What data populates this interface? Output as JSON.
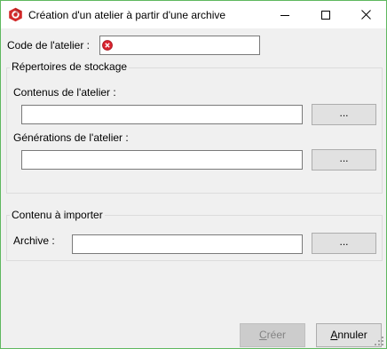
{
  "window": {
    "title": "Création d'un atelier à partir d'une archive",
    "controls": [
      "minimize-icon",
      "maximize-icon",
      "close-icon"
    ]
  },
  "workshop_code": {
    "label": "Code de l'atelier :",
    "value": "",
    "status_icon": "error-icon"
  },
  "storage_group": {
    "title": "Répertoires de stockage",
    "contents_label": "Contenus de l'atelier :",
    "contents_value": "",
    "contents_browse": "...",
    "generations_label": "Générations de l'atelier :",
    "generations_value": "",
    "generations_browse": "..."
  },
  "import_group": {
    "title": "Contenu à importer",
    "archive_label": "Archive :",
    "archive_value": "",
    "archive_browse": "..."
  },
  "footer": {
    "create_prefix": "C",
    "create_rest": "réer",
    "create_enabled": false,
    "cancel_prefix": "A",
    "cancel_rest": "nnuler"
  },
  "colors": {
    "window_border": "#5fb85f",
    "error": "#d9232e",
    "app_icon": "#d32a2a"
  }
}
